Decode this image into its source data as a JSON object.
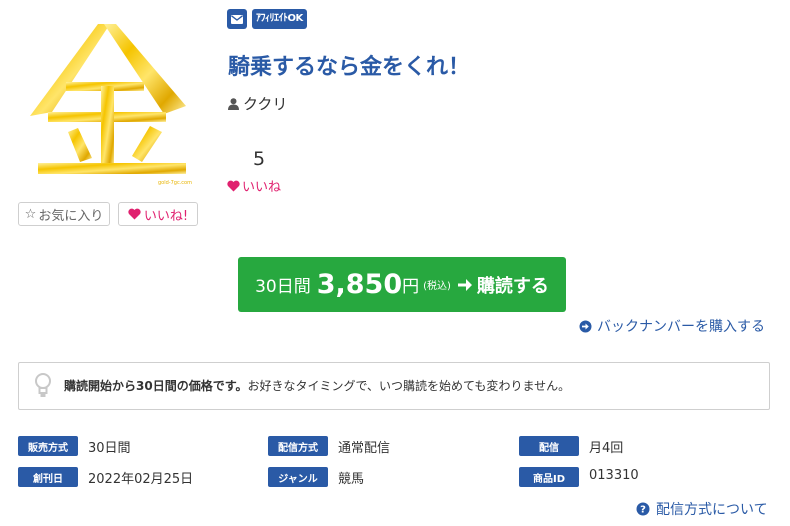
{
  "badges": {
    "affiliate": "ｱﾌｨﾘｴｲﾄOK"
  },
  "icons": {
    "mail": "mail-icon",
    "user": "user-icon",
    "heart": "heart-icon",
    "star": "star-outline-icon",
    "arrow": "arrow-right-icon",
    "circle_arrow": "circle-arrow-right-icon",
    "bulb": "lightbulb-icon",
    "question": "question-circle-icon"
  },
  "cover": {
    "watermark": "gold-7gc.com"
  },
  "title": "騎乗するなら金をくれ！",
  "author": "ククリ",
  "likes": {
    "count": "5",
    "label": "いいね"
  },
  "buttons": {
    "favorite": "お気に入り",
    "like": "いいね!"
  },
  "subscribe": {
    "period": "30日間",
    "price": "3,850",
    "yen": "円",
    "tax": "(税込)",
    "label": "購読する"
  },
  "backnumber_link": "バックナンバーを購入する",
  "info": {
    "bold": "購読開始から30日間の価格です。",
    "rest": "お好きなタイミングで、いつ購読を始めても変わりません。"
  },
  "meta": {
    "sale_type": {
      "label": "販売方式",
      "value": "30日間"
    },
    "delivery_type": {
      "label": "配信方式",
      "value": "通常配信"
    },
    "delivery": {
      "label": "配信",
      "value": "月4回"
    },
    "founded": {
      "label": "創刊日",
      "value": "2022年02月25日"
    },
    "genre": {
      "label": "ジャンル",
      "value": "競馬"
    },
    "product_id": {
      "label": "商品ID",
      "value": "013310"
    }
  },
  "about_link": "配信方式について",
  "colors": {
    "brand_blue": "#2a5aa6",
    "green": "#27a83f",
    "pink": "#e0216f",
    "gold": "#f2c200"
  }
}
